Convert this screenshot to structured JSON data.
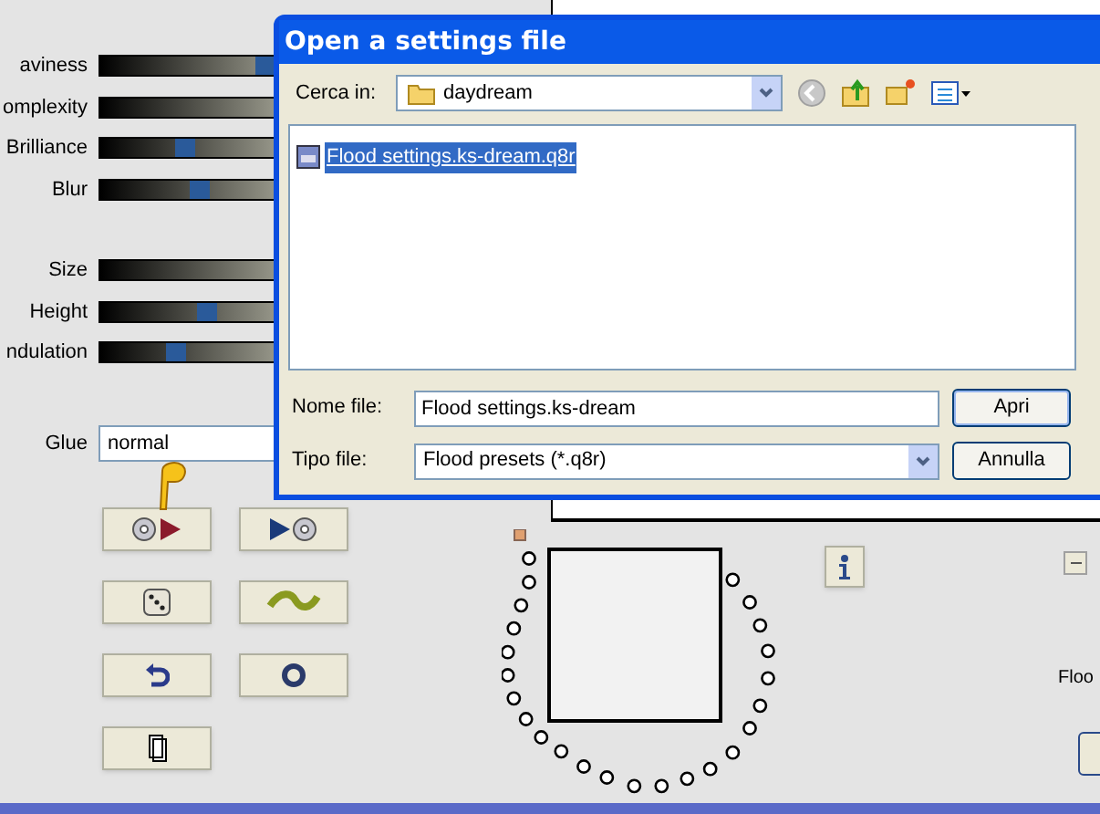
{
  "sliders": [
    {
      "label": "aviness",
      "level": 0.78
    },
    {
      "label": "omplexity"
    },
    {
      "label": "Brilliance",
      "level": 0.38
    },
    {
      "label": "Blur",
      "level": 0.45
    },
    {
      "label": "Size"
    },
    {
      "label": "Height",
      "level": 0.49
    },
    {
      "label": "ndulation",
      "level": 0.33
    }
  ],
  "glue": {
    "label": "Glue",
    "value": "normal"
  },
  "side_label": "Floo",
  "dialog": {
    "title": "Open a settings file",
    "look_in_label": "Cerca in:",
    "look_in_value": "daydream",
    "files": [
      {
        "name": "Flood settings.ks-dream.q8r",
        "selected": true
      }
    ],
    "file_name_label": "Nome file:",
    "file_name_value": "Flood settings.ks-dream",
    "file_type_label": "Tipo file:",
    "file_type_value": "Flood presets (*.q8r)",
    "buttons": [
      "Apri",
      "Annulla"
    ]
  }
}
